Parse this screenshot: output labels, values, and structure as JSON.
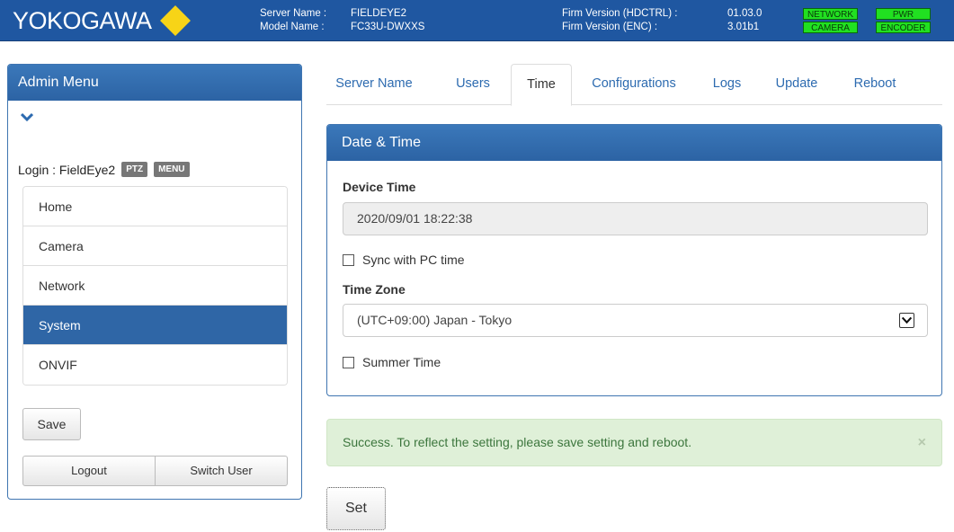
{
  "header": {
    "logo_text": "YOKOGAWA",
    "server_name_label": "Server Name :",
    "server_name": "FIELDEYE2",
    "model_name_label": "Model Name :",
    "model_name": "FC33U-DWXXS",
    "firm_hdctrl_label": "Firm Version (HDCTRL) :",
    "firm_hdctrl": "01.03.0",
    "firm_enc_label": "Firm Version (ENC) :",
    "firm_enc": "3.01b1",
    "badges": [
      "NETWORK",
      "PWR",
      "CAMERA",
      "ENCODER"
    ],
    "accent": "#1f57a1",
    "status_color": "#21e021"
  },
  "sidebar": {
    "title": "Admin Menu",
    "login_label": "Login : FieldEye2",
    "tags": [
      "PTZ",
      "MENU"
    ],
    "items": [
      {
        "label": "Home"
      },
      {
        "label": "Camera"
      },
      {
        "label": "Network"
      },
      {
        "label": "System"
      },
      {
        "label": "ONVIF"
      }
    ],
    "active_item": "System",
    "save_label": "Save",
    "logout_label": "Logout",
    "switch_user_label": "Switch User"
  },
  "tabs": [
    {
      "label": "Server Name"
    },
    {
      "label": "Users"
    },
    {
      "label": "Time"
    },
    {
      "label": "Configurations"
    },
    {
      "label": "Logs"
    },
    {
      "label": "Update"
    },
    {
      "label": "Reboot"
    }
  ],
  "active_tab": "Time",
  "panel": {
    "title": "Date & Time",
    "device_time_label": "Device Time",
    "device_time_value": "2020/09/01 18:22:38",
    "sync_label": "Sync with PC time",
    "sync_checked": false,
    "time_zone_label": "Time Zone",
    "time_zone_value": "(UTC+09:00) Japan - Tokyo",
    "summer_time_label": "Summer Time",
    "summer_time_checked": false
  },
  "alert": {
    "message": "Success. To reflect the setting, please save setting and reboot.",
    "close_glyph": "×"
  },
  "set_label": "Set"
}
